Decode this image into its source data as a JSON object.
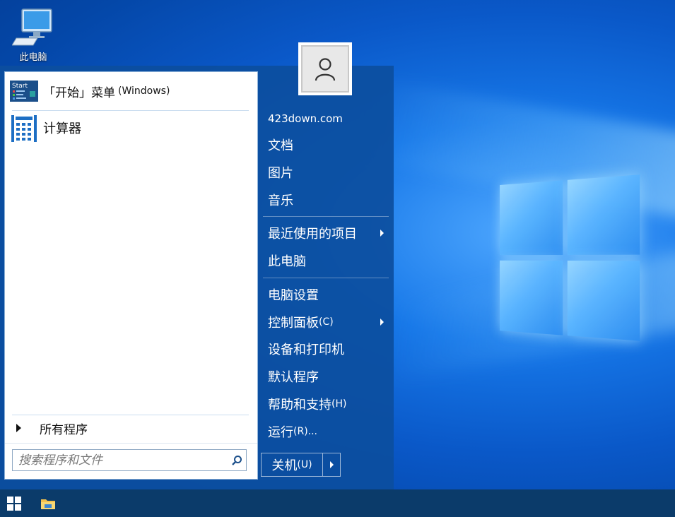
{
  "desktop": {
    "icon_label": "此电脑"
  },
  "start_menu": {
    "programs": [
      {
        "label": "「开始」菜单",
        "sub": "(Windows)",
        "icon": "start-menu-app-icon"
      },
      {
        "label": "计算器",
        "icon": "calculator-icon"
      }
    ],
    "all_programs_label": "所有程序",
    "search_placeholder": "搜索程序和文件",
    "user_avatar_icon": "user-icon",
    "right_items": {
      "user": "423down.com",
      "documents": "文档",
      "pictures": "图片",
      "music": "音乐",
      "recent": "最近使用的项目",
      "computer": "此电脑",
      "pc_settings": "电脑设置",
      "control_panel": "控制面板",
      "control_panel_key": "(C)",
      "devices": "设备和打印机",
      "default_programs": "默认程序",
      "help": "帮助和支持",
      "help_key": "(H)",
      "run": "运行",
      "run_key": "(R)..."
    },
    "shutdown_label": "关机",
    "shutdown_key": "(U)"
  },
  "taskbar": {
    "items": [
      "windows-start-icon",
      "file-explorer-icon"
    ]
  },
  "colors": {
    "menu_blue": "#0c4e9e",
    "taskbar": "#0b3b6a",
    "desktop_blue": "#0a58c8"
  }
}
